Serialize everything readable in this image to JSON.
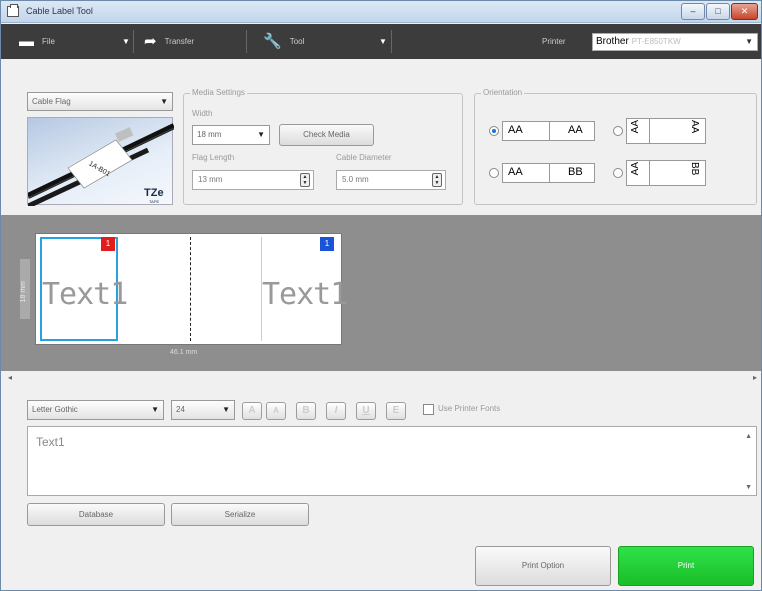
{
  "window": {
    "title": "Cable Label Tool",
    "controls": {
      "minimize": "–",
      "maximize": "□",
      "close": "✕"
    }
  },
  "toolbar": {
    "file": "File",
    "transfer": "Transfer",
    "tool": "Tool",
    "printer_label": "Printer",
    "printer_value": "Brother",
    "printer_model": "PT-E850TKW"
  },
  "icons": {
    "file": "file-icon",
    "transfer": "transfer-arrow-icon",
    "tool": "wrench-icon",
    "dropdown": "chevron-down-icon"
  },
  "label_type": {
    "value": "Cable Flag"
  },
  "preview": {
    "printed_text": "1A-B01",
    "logo": "TZe",
    "logo_sub": "TAPE"
  },
  "media_settings": {
    "title": "Media Settings",
    "width_label": "Width",
    "width_value": "18 mm",
    "check_media": "Check Media",
    "flag_length_label": "Flag Length",
    "flag_length_value": "13 mm",
    "cable_diameter_label": "Cable Diameter",
    "cable_diameter_value": "5.0 mm"
  },
  "orientation": {
    "title": "Orientation",
    "options": [
      {
        "left": "AA",
        "right": "AA",
        "selected": true
      },
      {
        "left": "AA",
        "right": "AA",
        "selected": false
      },
      {
        "left": "AA",
        "right": "BB",
        "selected": false
      },
      {
        "left": "AA",
        "right": "BB",
        "selected": false
      }
    ]
  },
  "canvas": {
    "ruler": "18 mm",
    "dimension": "46.1 mm",
    "left_badge": "1",
    "right_badge": "1",
    "left_text": "Text1",
    "right_text": "Text1",
    "colors": {
      "selected_border": "#27a2e0",
      "badge_red": "#e21b1b",
      "badge_blue": "#1b53d8"
    }
  },
  "format": {
    "font": "Letter Gothic",
    "size": "24",
    "buttons": [
      "A",
      "A",
      "B",
      "I",
      "U",
      "E"
    ],
    "use_printer_fonts": "Use Printer Fonts"
  },
  "editor": {
    "text": "Text1"
  },
  "buttons": {
    "database": "Database",
    "serialize": "Serialize",
    "print_option": "Print Option",
    "print": "Print",
    "print_color": "#1fc72e"
  }
}
